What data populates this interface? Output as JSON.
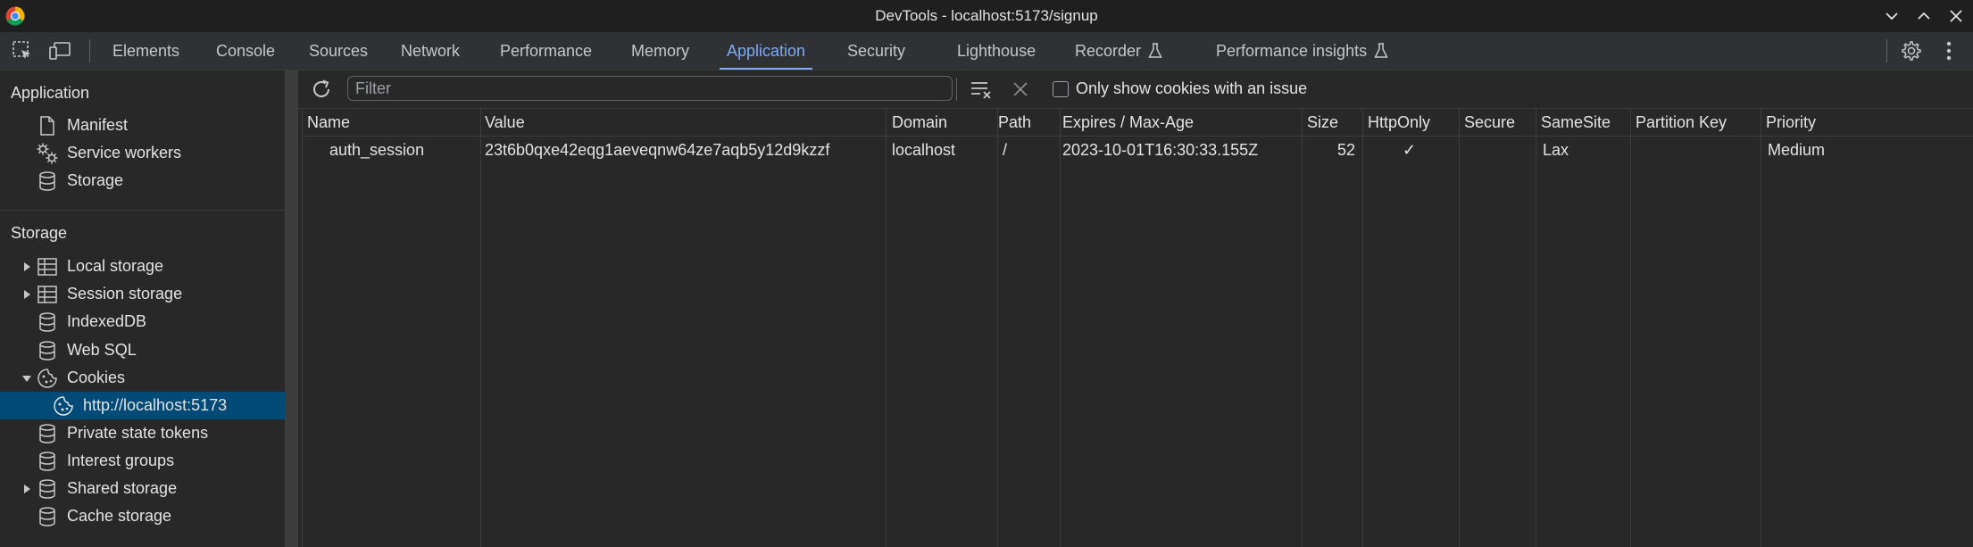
{
  "window": {
    "title": "DevTools - localhost:5173/signup"
  },
  "tabs": [
    {
      "label": "Elements"
    },
    {
      "label": "Console"
    },
    {
      "label": "Sources"
    },
    {
      "label": "Network"
    },
    {
      "label": "Performance"
    },
    {
      "label": "Memory"
    },
    {
      "label": "Application"
    },
    {
      "label": "Security"
    },
    {
      "label": "Lighthouse"
    },
    {
      "label": "Recorder"
    },
    {
      "label": "Performance insights"
    }
  ],
  "active_tab": "Application",
  "sidebar": {
    "application_title": "Application",
    "application_items": [
      {
        "label": "Manifest",
        "icon": "document-icon"
      },
      {
        "label": "Service workers",
        "icon": "gears-icon"
      },
      {
        "label": "Storage",
        "icon": "database-icon"
      }
    ],
    "storage_title": "Storage",
    "storage_items": [
      {
        "label": "Local storage",
        "icon": "table-icon",
        "expandable": true
      },
      {
        "label": "Session storage",
        "icon": "table-icon",
        "expandable": true
      },
      {
        "label": "IndexedDB",
        "icon": "database-icon"
      },
      {
        "label": "Web SQL",
        "icon": "database-icon"
      },
      {
        "label": "Cookies",
        "icon": "cookie-icon",
        "expanded": true
      },
      {
        "label": "http://localhost:5173",
        "icon": "cookie-icon",
        "selected": true
      },
      {
        "label": "Private state tokens",
        "icon": "database-icon"
      },
      {
        "label": "Interest groups",
        "icon": "database-icon"
      },
      {
        "label": "Shared storage",
        "icon": "database-icon",
        "expandable": true
      },
      {
        "label": "Cache storage",
        "icon": "database-icon"
      }
    ]
  },
  "toolbar": {
    "filter_placeholder": "Filter",
    "only_issue_label": "Only show cookies with an issue",
    "only_issue_checked": false
  },
  "cookies_table": {
    "columns": [
      "Name",
      "Value",
      "Domain",
      "Path",
      "Expires / Max-Age",
      "Size",
      "HttpOnly",
      "Secure",
      "SameSite",
      "Partition Key",
      "Priority"
    ],
    "rows": [
      {
        "name": "auth_session",
        "value": "23t6b0qxe42eqg1aeveqnw64ze7aqb5y12d9kzzf",
        "domain": "localhost",
        "path": "/",
        "expires": "2023-10-01T16:30:33.155Z",
        "size": "52",
        "httponly": "✓",
        "secure": "",
        "samesite": "Lax",
        "partition_key": "",
        "priority": "Medium"
      }
    ]
  },
  "colors": {
    "accent": "#7cacf8",
    "selected_row": "#004a77",
    "background": "#282828"
  }
}
